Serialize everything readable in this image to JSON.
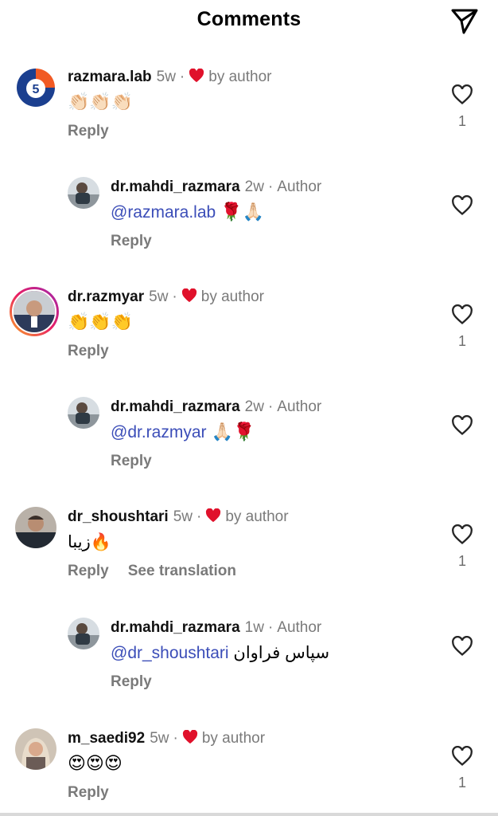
{
  "header": {
    "title": "Comments",
    "send_icon": "paper-plane-icon"
  },
  "colors": {
    "mention": "#3b4db8",
    "heart": "#e0112b",
    "muted": "#7a7a7a"
  },
  "comments": [
    {
      "username": "razmara.lab",
      "time": "5w",
      "liked_label": "by author",
      "text": "👏🏻👏🏻👏🏻",
      "reply": "Reply",
      "likes": "1",
      "replies": [
        {
          "username": "dr.mahdi_razmara",
          "time": "2w",
          "role": "Author",
          "mention": "@razmara.lab",
          "text": " 🌹🙏🏻",
          "reply": "Reply"
        }
      ]
    },
    {
      "username": "dr.razmyar",
      "time": "5w",
      "liked_label": "by author",
      "text": "👏👏👏",
      "reply": "Reply",
      "likes": "1",
      "replies": [
        {
          "username": "dr.mahdi_razmara",
          "time": "2w",
          "role": "Author",
          "mention": "@dr.razmyar",
          "text": " 🙏🏻🌹",
          "reply": "Reply"
        }
      ]
    },
    {
      "username": "dr_shoushtari",
      "time": "5w",
      "liked_label": "by author",
      "text": "🔥زیبا",
      "reply": "Reply",
      "see_translation": "See translation",
      "likes": "1",
      "replies": [
        {
          "username": "dr.mahdi_razmara",
          "time": "1w",
          "role": "Author",
          "mention": "@dr_shoushtari",
          "text": " سپاس فراوان",
          "reply": "Reply"
        }
      ]
    },
    {
      "username": "m_saedi92",
      "time": "5w",
      "liked_label": "by author",
      "text": "😍😍😍",
      "reply": "Reply",
      "likes": "1"
    }
  ]
}
